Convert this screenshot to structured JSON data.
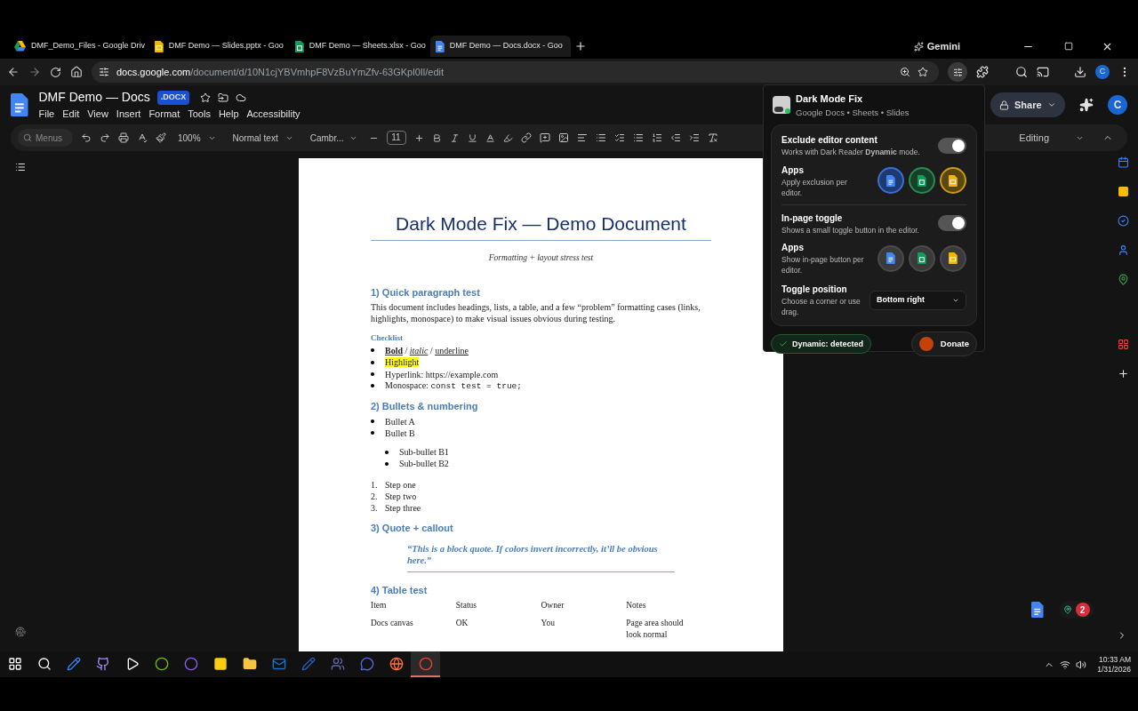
{
  "browser": {
    "tabs": [
      {
        "title": "DMF_Demo_Files - Google Driv",
        "kind": "drive",
        "selected": false
      },
      {
        "title": "DMF Demo — Slides.pptx - Goo",
        "kind": "slides",
        "selected": false
      },
      {
        "title": "DMF Demo — Sheets.xlsx - Goo",
        "kind": "sheets",
        "selected": false
      },
      {
        "title": "DMF Demo — Docs.docx - Goo",
        "kind": "docs",
        "selected": true
      }
    ],
    "assistant": "Gemini",
    "url_host": "docs.google.com",
    "url_path": "/document/d/10N1cjYBVmhpF8VzBuYmZfv-63GKpl0Il/edit",
    "profile": "C"
  },
  "docs": {
    "title": "DMF Demo — Docs",
    "badge": ".DOCX",
    "menus": [
      "File",
      "Edit",
      "View",
      "Insert",
      "Format",
      "Tools",
      "Help",
      "Accessibility"
    ],
    "toolbar": {
      "search_placeholder": "Menus",
      "zoom": "100%",
      "style": "Normal text",
      "font": "Cambr...",
      "font_size": "11"
    },
    "share": "Share",
    "avatar": "C",
    "mode": "Editing"
  },
  "page": {
    "title": "Dark Mode Fix — Demo Document",
    "subtitle": "Formatting + layout stress test",
    "blocks": [
      {
        "kind": "heading",
        "text": "1) Quick paragraph test"
      },
      {
        "kind": "paragraph",
        "text": "This document includes headings, lists, a table, and a few “problem” formatting cases (links, highlights, monospace) to make visual issues obvious during testing."
      },
      {
        "kind": "label",
        "text": "Checklist"
      },
      {
        "kind": "bullets",
        "items": [
          {
            "segments": [
              {
                "text": "Bold",
                "kind": "bold"
              },
              {
                "text": " / ",
                "kind": "plain"
              },
              {
                "text": "italic",
                "kind": "italic"
              },
              {
                "text": " / ",
                "kind": "plain"
              },
              {
                "text": "underline",
                "kind": "underline"
              }
            ]
          },
          {
            "segments": [
              {
                "text": "Highlight",
                "kind": "highlight"
              }
            ]
          },
          {
            "segments": [
              {
                "text": "Hyperlink: https://example.com",
                "kind": "plain"
              }
            ]
          },
          {
            "segments": [
              {
                "text": "Monospace: ",
                "kind": "plain"
              },
              {
                "text": "const test = true;",
                "kind": "mono"
              }
            ]
          }
        ]
      },
      {
        "kind": "heading",
        "text": "2) Bullets & numbering"
      },
      {
        "kind": "bullets",
        "items": [
          {
            "segments": [
              {
                "text": "Bullet A",
                "kind": "plain"
              }
            ]
          },
          {
            "segments": [
              {
                "text": "Bullet B",
                "kind": "plain"
              }
            ]
          }
        ]
      },
      {
        "kind": "subbullets",
        "items": [
          {
            "segments": [
              {
                "text": "Sub-bullet B1",
                "kind": "plain"
              }
            ]
          },
          {
            "segments": [
              {
                "text": "Sub-bullet B2",
                "kind": "plain"
              }
            ]
          }
        ]
      },
      {
        "kind": "numbered",
        "items": [
          {
            "number": "1.",
            "text": "Step one"
          },
          {
            "number": "2.",
            "text": "Step two"
          },
          {
            "number": "3.",
            "text": "Step three"
          }
        ]
      },
      {
        "kind": "heading",
        "text": "3) Quote + callout"
      },
      {
        "kind": "quote",
        "text": "“This is a block quote. If colors invert incorrectly, it’ll be obvious here.”"
      },
      {
        "kind": "heading",
        "text": "4) Table test"
      },
      {
        "kind": "table",
        "columns": [
          "Item",
          "Status",
          "Owner",
          "Notes"
        ],
        "rows": [
          [
            "Docs canvas",
            "OK",
            "You",
            "Page area should look normal"
          ]
        ]
      }
    ]
  },
  "popup": {
    "title": "Dark Mode Fix",
    "subtitle": "Google Docs • Sheets • Slides",
    "groups": [
      {
        "toggle": {
          "title": "Exclude editor content",
          "desc": "Works with Dark Reader **Dynamic** mode.",
          "on": true
        },
        "apps": {
          "title": "Apps",
          "desc": "Apply exclusion per editor.",
          "items": [
            {
              "kind": "docs",
              "selected": true
            },
            {
              "kind": "sheets",
              "selected": true
            },
            {
              "kind": "slides",
              "selected": true
            }
          ]
        }
      },
      {
        "toggle": {
          "title": "In-page toggle",
          "desc": "Shows a small toggle button in the editor.",
          "on": true
        },
        "apps": {
          "title": "Apps",
          "desc": "Show in-page button per editor.",
          "items": [
            {
              "kind": "docs",
              "selected": false
            },
            {
              "kind": "sheets",
              "selected": false
            },
            {
              "kind": "slides",
              "selected": false
            }
          ]
        }
      }
    ],
    "position": {
      "title": "Toggle position",
      "desc": "Choose a corner or use drag.",
      "value": "Bottom right"
    },
    "status": "Dynamic: detected",
    "donate": "Donate"
  },
  "floating_badge": "2",
  "taskbar": {
    "apps": [
      {
        "kind": "windows",
        "selected": false
      },
      {
        "kind": "search",
        "selected": false
      },
      {
        "kind": "editor",
        "selected": false
      },
      {
        "kind": "github",
        "selected": false
      },
      {
        "kind": "player",
        "selected": false
      },
      {
        "kind": "nvidia",
        "selected": false
      },
      {
        "kind": "ring",
        "selected": false
      },
      {
        "kind": "notes",
        "selected": false
      },
      {
        "kind": "folder",
        "selected": false
      },
      {
        "kind": "outlook",
        "selected": false
      },
      {
        "kind": "word",
        "selected": false
      },
      {
        "kind": "teams",
        "selected": false
      },
      {
        "kind": "discord",
        "selected": false
      },
      {
        "kind": "firefox",
        "selected": false
      },
      {
        "kind": "chrome",
        "selected": true
      }
    ],
    "time": "10:33 AM",
    "date": "1/31/2026"
  }
}
